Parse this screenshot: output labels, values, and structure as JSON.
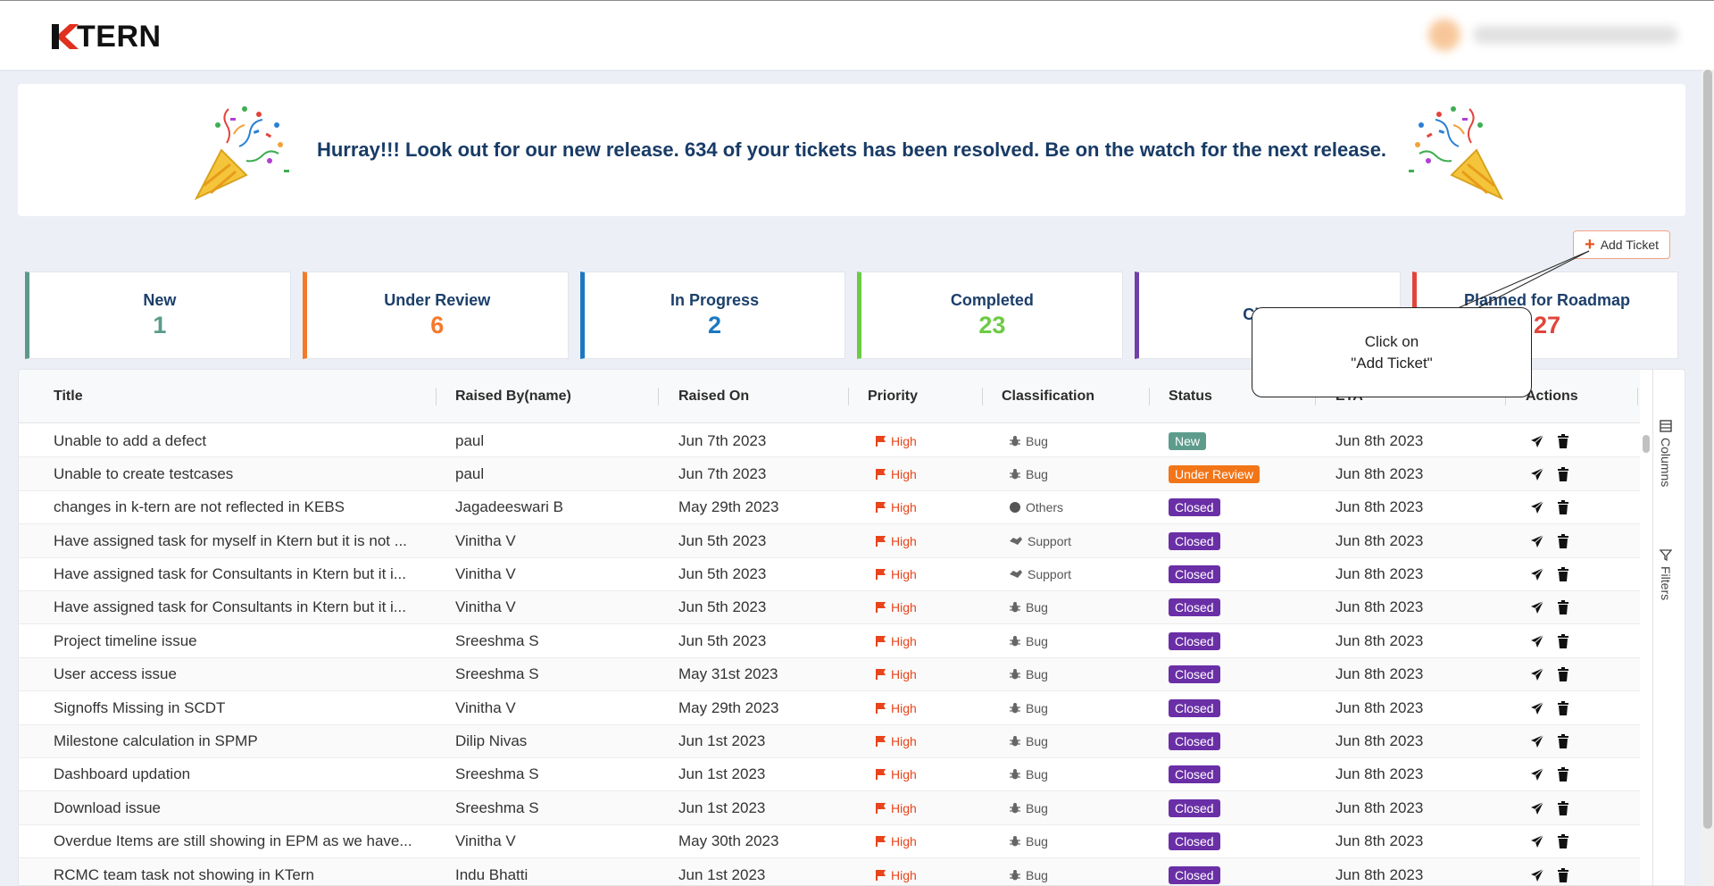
{
  "brand": {
    "name": "TERN",
    "mark": "K"
  },
  "banner": {
    "message": "Hurray!!! Look out for our new release. 634 of your tickets has been resolved. Be on the watch for the next release."
  },
  "toolbar": {
    "add_ticket_label": "Add Ticket"
  },
  "callout": {
    "text": "Click on\n\"Add Ticket\""
  },
  "cards": [
    {
      "label": "New",
      "count": "1",
      "color": "#5b9a8b"
    },
    {
      "label": "Under Review",
      "count": "6",
      "color": "#f47a2b"
    },
    {
      "label": "In Progress",
      "count": "2",
      "color": "#1a78c2"
    },
    {
      "label": "Completed",
      "count": "23",
      "color": "#6ccb45"
    },
    {
      "label": "Closed",
      "count": "",
      "color": "#7040aa"
    },
    {
      "label": "Planned for Roadmap",
      "count": "27",
      "color": "#e2443b"
    }
  ],
  "table": {
    "columns": [
      "Title",
      "Raised By(name)",
      "Raised On",
      "Priority",
      "Classification",
      "Status",
      "ETA",
      "Actions"
    ],
    "rows": [
      {
        "title": "Unable to add a defect",
        "raised_by": "paul",
        "raised_on": "Jun 7th 2023",
        "priority": "High",
        "classification": "Bug",
        "status": "New",
        "eta": "Jun 8th 2023"
      },
      {
        "title": "Unable to create testcases",
        "raised_by": "paul",
        "raised_on": "Jun 7th 2023",
        "priority": "High",
        "classification": "Bug",
        "status": "Under Review",
        "eta": "Jun 8th 2023"
      },
      {
        "title": "changes in k-tern are not reflected in KEBS",
        "raised_by": "Jagadeeswari B",
        "raised_on": "May 29th 2023",
        "priority": "High",
        "classification": "Others",
        "status": "Closed",
        "eta": "Jun 8th 2023"
      },
      {
        "title": "Have assigned task for myself in Ktern but it is not ...",
        "raised_by": "Vinitha V",
        "raised_on": "Jun 5th 2023",
        "priority": "High",
        "classification": "Support",
        "status": "Closed",
        "eta": "Jun 8th 2023"
      },
      {
        "title": "Have assigned task for Consultants in Ktern but it i...",
        "raised_by": "Vinitha V",
        "raised_on": "Jun 5th 2023",
        "priority": "High",
        "classification": "Support",
        "status": "Closed",
        "eta": "Jun 8th 2023"
      },
      {
        "title": "Have assigned task for Consultants in Ktern but it i...",
        "raised_by": "Vinitha V",
        "raised_on": "Jun 5th 2023",
        "priority": "High",
        "classification": "Bug",
        "status": "Closed",
        "eta": "Jun 8th 2023"
      },
      {
        "title": "Project timeline issue",
        "raised_by": "Sreeshma S",
        "raised_on": "Jun 5th 2023",
        "priority": "High",
        "classification": "Bug",
        "status": "Closed",
        "eta": "Jun 8th 2023"
      },
      {
        "title": "User access issue",
        "raised_by": "Sreeshma S",
        "raised_on": "May 31st 2023",
        "priority": "High",
        "classification": "Bug",
        "status": "Closed",
        "eta": "Jun 8th 2023"
      },
      {
        "title": "Signoffs Missing in SCDT",
        "raised_by": "Vinitha V",
        "raised_on": "May 29th 2023",
        "priority": "High",
        "classification": "Bug",
        "status": "Closed",
        "eta": "Jun 8th 2023"
      },
      {
        "title": "Milestone calculation in SPMP",
        "raised_by": "Dilip Nivas",
        "raised_on": "Jun 1st 2023",
        "priority": "High",
        "classification": "Bug",
        "status": "Closed",
        "eta": "Jun 8th 2023"
      },
      {
        "title": "Dashboard updation",
        "raised_by": "Sreeshma S",
        "raised_on": "Jun 1st 2023",
        "priority": "High",
        "classification": "Bug",
        "status": "Closed",
        "eta": "Jun 8th 2023"
      },
      {
        "title": "Download issue",
        "raised_by": "Sreeshma S",
        "raised_on": "Jun 1st 2023",
        "priority": "High",
        "classification": "Bug",
        "status": "Closed",
        "eta": "Jun 8th 2023"
      },
      {
        "title": "Overdue Items are still showing in EPM as we have...",
        "raised_by": "Vinitha V",
        "raised_on": "May 30th 2023",
        "priority": "High",
        "classification": "Bug",
        "status": "Closed",
        "eta": "Jun 8th 2023"
      },
      {
        "title": "RCMC team task not showing in KTern",
        "raised_by": "Indu Bhatti",
        "raised_on": "Jun 1st 2023",
        "priority": "High",
        "classification": "Bug",
        "status": "Closed",
        "eta": "Jun 8th 2023"
      }
    ]
  },
  "status_colors": {
    "New": "#5d9c8c",
    "Under Review": "#f27518",
    "Closed": "#6a2fa6"
  },
  "side_panel": {
    "columns_label": "Columns",
    "filters_label": "Filters"
  },
  "icons": {
    "priority": "flag-icon",
    "bug": "bug-icon",
    "support": "handshake-icon",
    "others": "dot-icon",
    "send": "send-icon",
    "delete": "trash-icon"
  }
}
